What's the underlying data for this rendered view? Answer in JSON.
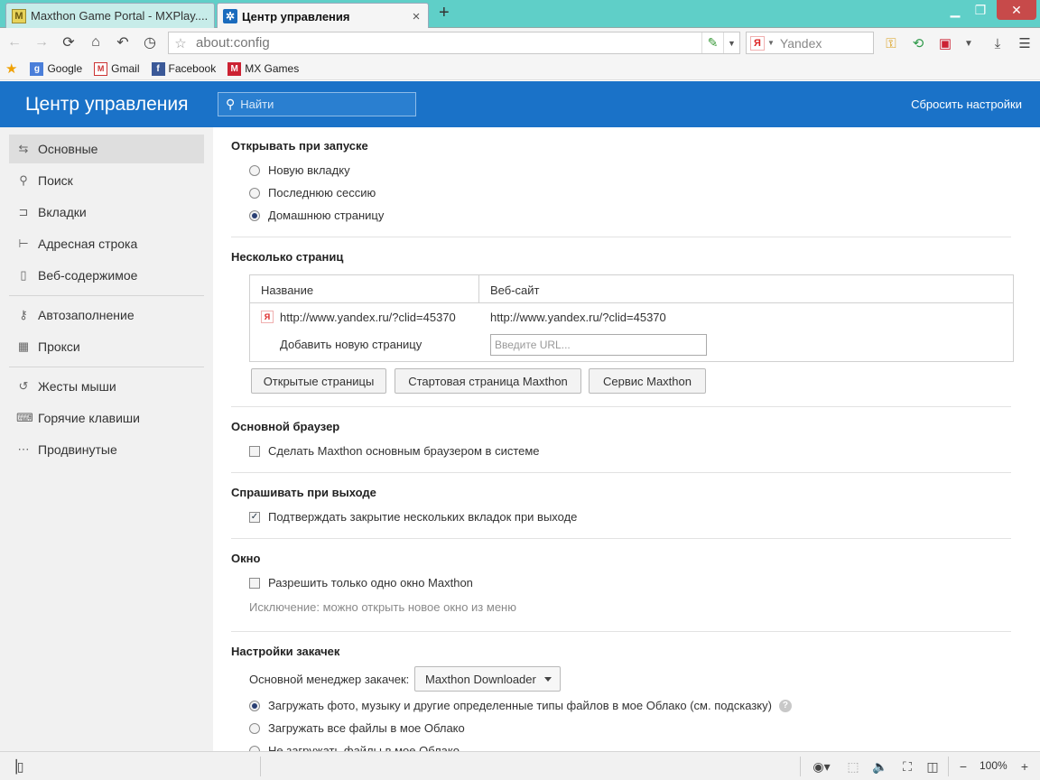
{
  "browser": {
    "tabs": [
      {
        "title": "Maxthon Game Portal - MXPlay....",
        "icon": "maxthon-m-icon"
      },
      {
        "title": "Центр управления",
        "icon": "settings-gear-icon",
        "close": "×"
      }
    ],
    "new_tab": "+",
    "address": "about:config",
    "search_engine": "Yandex",
    "search_icon_letter": "Я",
    "bookmarks": [
      {
        "label": "Google",
        "icon": "google-icon",
        "glyph": "g"
      },
      {
        "label": "Gmail",
        "icon": "gmail-icon",
        "glyph": "M"
      },
      {
        "label": "Facebook",
        "icon": "facebook-icon",
        "glyph": "f"
      },
      {
        "label": "MX Games",
        "icon": "mx-games-icon",
        "glyph": "M"
      }
    ],
    "zoom": "100%",
    "colors": {
      "tabstrip": "#5fcfc8",
      "header": "#1a72c8",
      "close_button": "#c74a4a"
    }
  },
  "header": {
    "title": "Центр управления",
    "search_placeholder": "Найти",
    "reset_label": "Сбросить настройки"
  },
  "sidebar": {
    "items": [
      {
        "label": "Основные",
        "icon": "sliders-icon",
        "active": true
      },
      {
        "label": "Поиск",
        "icon": "search-icon"
      },
      {
        "label": "Вкладки",
        "icon": "tabs-icon"
      },
      {
        "label": "Адресная строка",
        "icon": "address-bar-icon"
      },
      {
        "label": "Веб-содержимое",
        "icon": "document-icon"
      },
      {
        "label": "Автозаполнение",
        "icon": "key-icon"
      },
      {
        "label": "Прокси",
        "icon": "proxy-icon"
      },
      {
        "label": "Жесты мыши",
        "icon": "mouse-gesture-icon"
      },
      {
        "label": "Горячие клавиши",
        "icon": "hotkeys-icon"
      },
      {
        "label": "Продвинутые",
        "icon": "more-icon"
      }
    ]
  },
  "startup": {
    "title": "Открывать при запуске",
    "options": [
      "Новую вкладку",
      "Последнюю сессию",
      "Домашнюю страницу"
    ],
    "selected": 2
  },
  "pages": {
    "title": "Несколько страниц",
    "col_name": "Название",
    "col_site": "Веб-сайт",
    "rows": [
      {
        "name": "http://www.yandex.ru/?clid=45370",
        "site": "http://www.yandex.ru/?clid=45370"
      }
    ],
    "add_label": "Добавить новую страницу",
    "url_placeholder": "Введите URL...",
    "buttons": [
      "Открытые страницы",
      "Стартовая страница Maxthon",
      "Сервис Maxthon"
    ]
  },
  "default_browser": {
    "title": "Основной браузер",
    "option": "Сделать Maxthon основным браузером в системе",
    "checked": false
  },
  "exit": {
    "title": "Спрашивать при выходе",
    "option": "Подтверждать закрытие нескольких вкладок при выходе",
    "checked": true
  },
  "window": {
    "title": "Окно",
    "option": "Разрешить только одно окно Maxthon",
    "checked": false,
    "hint": "Исключение: можно открыть новое окно из меню"
  },
  "downloads": {
    "title": "Настройки закачек",
    "manager_label": "Основной менеджер закачек:",
    "manager_value": "Maxthon Downloader",
    "options": [
      "Загружать фото, музыку и другие определенные типы файлов в мое Облако (см. подсказку)",
      "Загружать все файлы в мое Облако",
      "Не загружать файлы в мое Облако"
    ],
    "selected": 0
  }
}
